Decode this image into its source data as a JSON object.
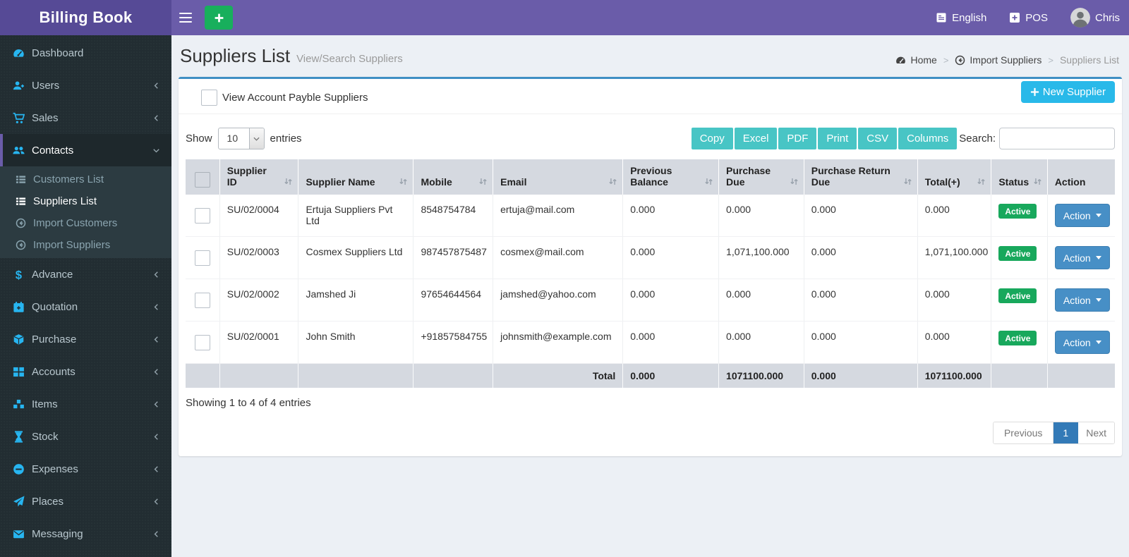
{
  "app": {
    "brand": "Billing Book"
  },
  "colors": {
    "topbar": "#6a5ca9",
    "logo_bg": "#564a96",
    "sidebar": "#222d32",
    "icon_accent": "#27b5f0",
    "export_button": "#48c5c5",
    "new_supplier_button": "#29b9e9",
    "action_button": "#478fc6",
    "status_active": "#18a85c",
    "table_header": "#d5d9e0",
    "pagination_active": "#337ab7",
    "card_top_border": "#3f8fc4",
    "quick_add_green": "#18af5c"
  },
  "topbar": {
    "language": "English",
    "pos_label": "POS",
    "user_name": "Chris"
  },
  "sidebar": {
    "items": [
      {
        "label": "Dashboard",
        "icon": "dashboard-icon",
        "chevron": "",
        "active": false
      },
      {
        "label": "Users",
        "icon": "user-plus-icon",
        "chevron": "left",
        "active": false
      },
      {
        "label": "Sales",
        "icon": "cart-icon",
        "chevron": "left",
        "active": false
      },
      {
        "label": "Contacts",
        "icon": "users-group-icon",
        "chevron": "down",
        "active": true,
        "children": [
          {
            "label": "Customers List",
            "icon": "list-icon",
            "active": false
          },
          {
            "label": "Suppliers List",
            "icon": "list-icon",
            "active": true
          },
          {
            "label": "Import Customers",
            "icon": "import-icon",
            "active": false
          },
          {
            "label": "Import Suppliers",
            "icon": "import-icon",
            "active": false
          }
        ]
      },
      {
        "label": "Advance",
        "icon": "dollar-icon",
        "chevron": "left",
        "active": false
      },
      {
        "label": "Quotation",
        "icon": "calendar-plus-icon",
        "chevron": "left",
        "active": false
      },
      {
        "label": "Purchase",
        "icon": "cube-icon",
        "chevron": "left",
        "active": false
      },
      {
        "label": "Accounts",
        "icon": "grid-icon",
        "chevron": "left",
        "active": false
      },
      {
        "label": "Items",
        "icon": "cubes-icon",
        "chevron": "left",
        "active": false
      },
      {
        "label": "Stock",
        "icon": "hourglass-icon",
        "chevron": "left",
        "active": false
      },
      {
        "label": "Expenses",
        "icon": "minus-circle-icon",
        "chevron": "left",
        "active": false
      },
      {
        "label": "Places",
        "icon": "paper-plane-icon",
        "chevron": "left",
        "active": false
      },
      {
        "label": "Messaging",
        "icon": "envelope-icon",
        "chevron": "left",
        "active": false
      }
    ]
  },
  "page": {
    "title": "Suppliers List",
    "subtitle": "View/Search Suppliers",
    "breadcrumb": [
      {
        "label": "Home",
        "icon": "dashboard-icon",
        "current": false
      },
      {
        "label": "Import Suppliers",
        "icon": "import-icon",
        "current": false
      },
      {
        "label": "Suppliers List",
        "icon": "",
        "current": true
      }
    ]
  },
  "toolbar": {
    "payable_filter_label": "View Account Payble Suppliers",
    "payable_filter_checked": false,
    "new_supplier_label": "New Supplier",
    "show_label": "Show",
    "entries_label": "entries",
    "page_length": "10",
    "export_buttons": [
      "Copy",
      "Excel",
      "PDF",
      "Print",
      "CSV",
      "Columns"
    ],
    "search_label": "Search:",
    "search_value": "",
    "search_placeholder": ""
  },
  "table": {
    "columns": [
      "Supplier ID",
      "Supplier Name",
      "Mobile",
      "Email",
      "Previous Balance",
      "Purchase Due",
      "Purchase Return Due",
      "Total(+)",
      "Status",
      "Action"
    ],
    "rows": [
      {
        "supplier_id": "SU/02/0004",
        "name": "Ertuja Suppliers Pvt Ltd",
        "mobile": "8548754784",
        "email": "ertuja@mail.com",
        "previous_balance": "0.000",
        "purchase_due": "0.000",
        "purchase_return_due": "0.000",
        "total": "0.000",
        "status": "Active",
        "action_label": "Action"
      },
      {
        "supplier_id": "SU/02/0003",
        "name": "Cosmex Suppliers Ltd",
        "mobile": "987457875487",
        "email": "cosmex@mail.com",
        "previous_balance": "0.000",
        "purchase_due": "1,071,100.000",
        "purchase_return_due": "0.000",
        "total": "1,071,100.000",
        "status": "Active",
        "action_label": "Action"
      },
      {
        "supplier_id": "SU/02/0002",
        "name": "Jamshed Ji",
        "mobile": "97654644564",
        "email": "jamshed@yahoo.com",
        "previous_balance": "0.000",
        "purchase_due": "0.000",
        "purchase_return_due": "0.000",
        "total": "0.000",
        "status": "Active",
        "action_label": "Action"
      },
      {
        "supplier_id": "SU/02/0001",
        "name": "John Smith",
        "mobile": "+91857584755",
        "email": "johnsmith@example.com",
        "previous_balance": "0.000",
        "purchase_due": "0.000",
        "purchase_return_due": "0.000",
        "total": "0.000",
        "status": "Active",
        "action_label": "Action"
      }
    ],
    "footer": {
      "label": "Total",
      "previous_balance": "0.000",
      "purchase_due": "1071100.000",
      "purchase_return_due": "0.000",
      "total": "1071100.000"
    }
  },
  "list_footer": {
    "showing_text": "Showing 1 to 4 of 4 entries",
    "pagination": {
      "previous": "Previous",
      "page": "1",
      "next": "Next"
    }
  }
}
